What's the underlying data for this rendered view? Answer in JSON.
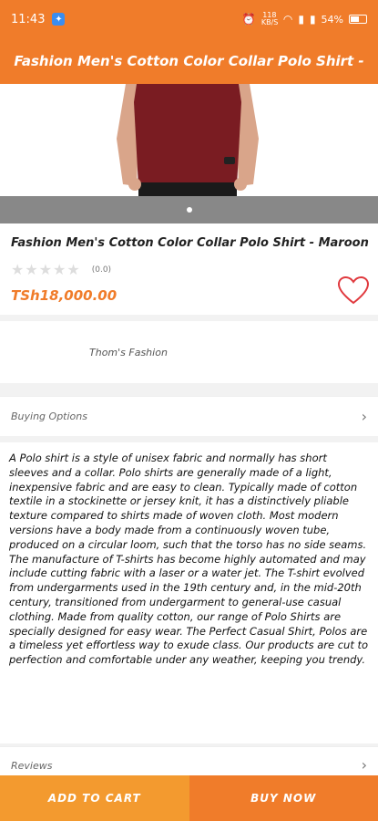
{
  "status_bar": {
    "time": "11:43",
    "net_speed": "118 KB/S",
    "battery": "54%",
    "battery_level": 0.54
  },
  "header": {
    "title": "Fashion Men's Cotton Color Collar Polo Shirt -"
  },
  "product": {
    "name": "Fashion Men's Cotton Color Collar Polo Shirt - Maroon",
    "rating_stars": "★★★★★",
    "rating_count": "(0.0)",
    "price": "TSh18,000.00",
    "shirt_color": "#7a1c22"
  },
  "seller": {
    "name": "Thom's Fashion"
  },
  "buying_options": {
    "label": "Buying Options"
  },
  "description": {
    "text": "A Polo shirt is a style of unisex fabric and normally has short sleeves and a collar. Polo shirts are generally made of a light, inexpensive fabric and are easy to clean. Typically made of cotton textile in a stockinette or jersey knit, it has a distinctively pliable texture compared to shirts made of woven cloth. Most modern versions have a body made from a continuously woven tube, produced on a circular loom, such that the torso has no side seams. The manufacture of T-shirts has become highly automated and may include cutting fabric with a laser or a water jet. The T-shirt evolved from undergarments used in the 19th century and, in the mid-20th century, transitioned from undergarment to general-use casual clothing. Made from quality cotton, our range of Polo Shirts are specially designed for easy wear. The Perfect Casual Shirt, Polos are a timeless yet effortless way to exude class. Our products are cut to perfection and comfortable under any weather, keeping you trendy."
  },
  "reviews": {
    "label": "Reviews"
  },
  "actions": {
    "add_to_cart": "ADD TO CART",
    "buy_now": "BUY NOW"
  },
  "colors": {
    "accent": "#f07c2a",
    "accent_light": "#f39a2f"
  }
}
